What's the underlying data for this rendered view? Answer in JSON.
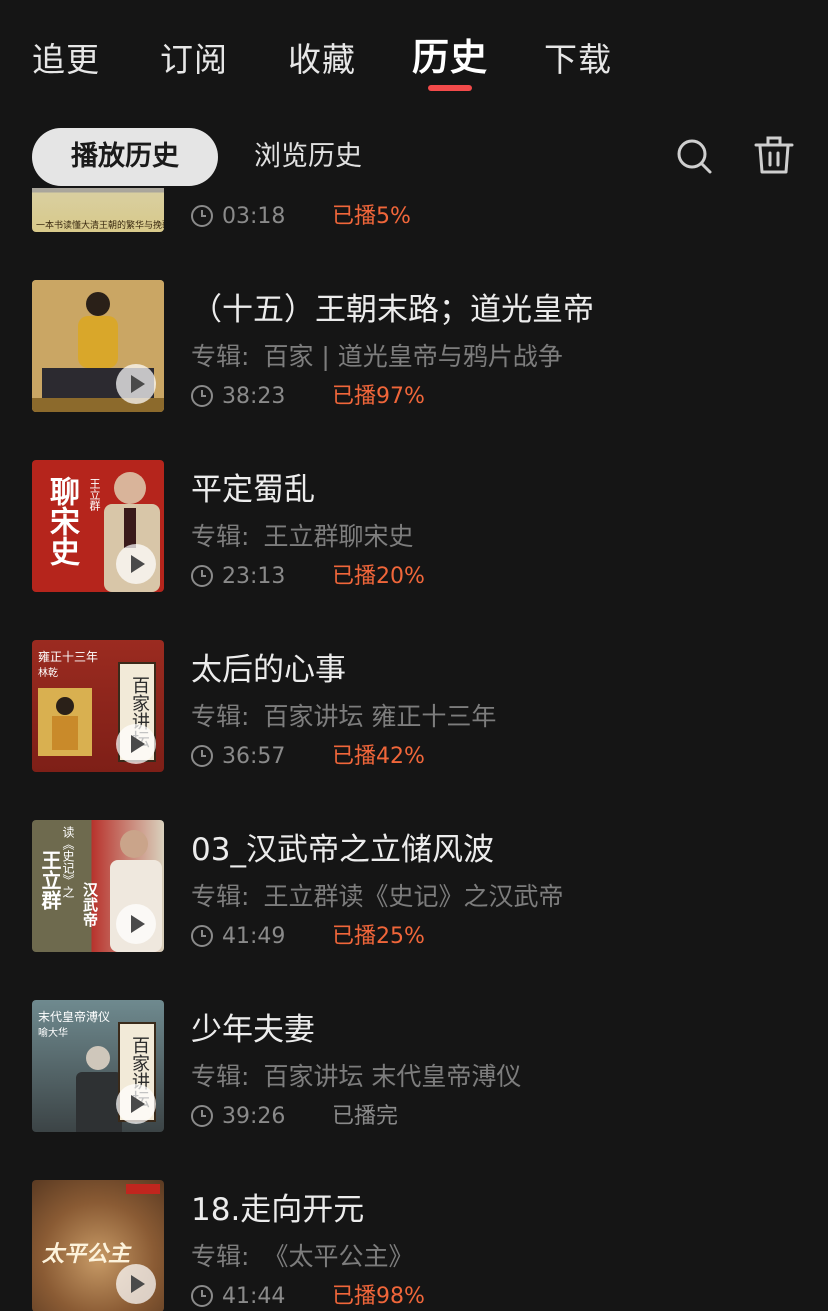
{
  "tabs": [
    "追更",
    "订阅",
    "收藏",
    "历史",
    "下载"
  ],
  "active_tab": "历史",
  "subtabs": {
    "active": "播放历史",
    "other": "浏览历史"
  },
  "icons": {
    "search": "search-icon",
    "delete": "trash-icon"
  },
  "accent_color": "#f24a4a",
  "progress_color": "#f0663a",
  "album_label": "专辑:",
  "items": [
    {
      "duration": "03:18",
      "progress": "已播5%",
      "thumb_caption": "一本书读懂大清王朝的繁华与挽歌"
    },
    {
      "title": "（十五）王朝末路；道光皇帝",
      "album": "百家 | 道光皇帝与鸦片战争",
      "duration": "38:23",
      "progress": "已播97%"
    },
    {
      "title": "平定蜀乱",
      "album": "王立群聊宋史",
      "duration": "23:13",
      "progress": "已播20%",
      "thumb_text": "聊宋史",
      "thumb_small": "王立群"
    },
    {
      "title": "太后的心事",
      "album": "百家讲坛 雍正十三年",
      "duration": "36:57",
      "progress": "已播42%",
      "thumb_text": "雍正十三年",
      "thumb_small": "林乾",
      "thumb_tag": "百家讲坛"
    },
    {
      "title": "03_汉武帝之立储风波",
      "album": "王立群读《史记》之汉武帝",
      "duration": "41:49",
      "progress": "已播25%",
      "thumb_text": "王立群",
      "thumb_small": "读《史记》之",
      "thumb_tag": "汉武帝"
    },
    {
      "title": "少年夫妻",
      "album": "百家讲坛 末代皇帝溥仪",
      "duration": "39:26",
      "progress": "已播完",
      "thumb_text": "末代皇帝溥仪",
      "thumb_small": "喻大华",
      "thumb_tag": "百家讲坛"
    },
    {
      "title": "18.走向开元",
      "album": "《太平公主》",
      "duration": "41:44",
      "progress": "已播98%",
      "thumb_text": "太平公主"
    }
  ]
}
